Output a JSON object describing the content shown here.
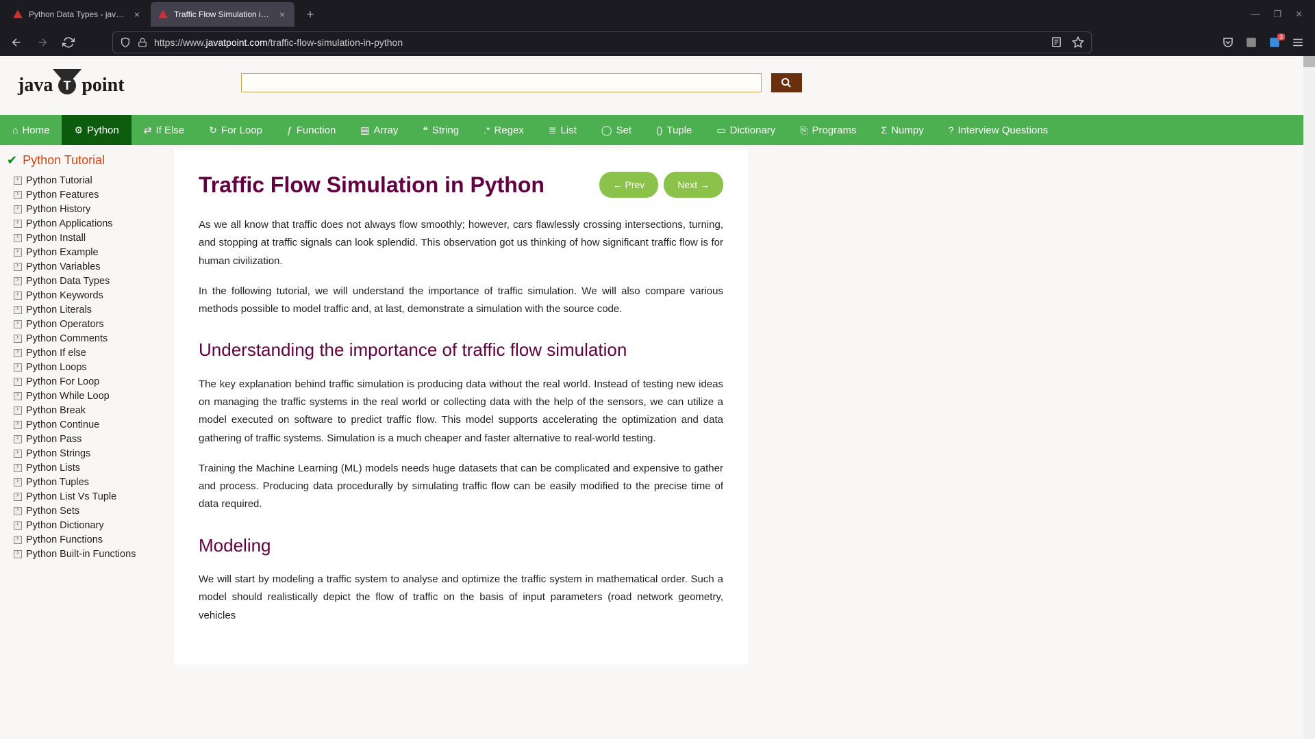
{
  "browser": {
    "tabs": [
      {
        "title": "Python Data Types - javatpoint",
        "active": false
      },
      {
        "title": "Traffic Flow Simulation in Pytho",
        "active": true
      }
    ],
    "url_prefix": "https://www.",
    "url_domain": "javatpoint.com",
    "url_path": "/traffic-flow-simulation-in-python",
    "ext_badge": "3"
  },
  "logo": {
    "part1": "java",
    "part2": "T",
    "part3": "point"
  },
  "green_nav": [
    {
      "label": "Home"
    },
    {
      "label": "Python"
    },
    {
      "label": "If Else"
    },
    {
      "label": "For Loop"
    },
    {
      "label": "Function"
    },
    {
      "label": "Array"
    },
    {
      "label": "String"
    },
    {
      "label": "Regex"
    },
    {
      "label": "List"
    },
    {
      "label": "Set"
    },
    {
      "label": "Tuple"
    },
    {
      "label": "Dictionary"
    },
    {
      "label": "Programs"
    },
    {
      "label": "Numpy"
    },
    {
      "label": "Interview Questions"
    }
  ],
  "sidebar": {
    "header": "Python Tutorial",
    "items": [
      "Python Tutorial",
      "Python Features",
      "Python History",
      "Python Applications",
      "Python Install",
      "Python Example",
      "Python Variables",
      "Python Data Types",
      "Python Keywords",
      "Python Literals",
      "Python Operators",
      "Python Comments",
      "Python If else",
      "Python Loops",
      "Python For Loop",
      "Python While Loop",
      "Python Break",
      "Python Continue",
      "Python Pass",
      "Python Strings",
      "Python Lists",
      "Python Tuples",
      "Python List Vs Tuple",
      "Python Sets",
      "Python Dictionary",
      "Python Functions",
      "Python Built-in Functions"
    ]
  },
  "article": {
    "title": "Traffic Flow Simulation in Python",
    "prev": "← Prev",
    "next": "Next →",
    "p1": "As we all know that traffic does not always flow smoothly; however, cars flawlessly crossing intersections, turning, and stopping at traffic signals can look splendid. This observation got us thinking of how significant traffic flow is for human civilization.",
    "p2": "In the following tutorial, we will understand the importance of traffic simulation. We will also compare various methods possible to model traffic and, at last, demonstrate a simulation with the source code.",
    "h2a": "Understanding the importance of traffic flow simulation",
    "p3": "The key explanation behind traffic simulation is producing data without the real world. Instead of testing new ideas on managing the traffic systems in the real world or collecting data with the help of the sensors, we can utilize a model executed on software to predict traffic flow. This model supports accelerating the optimization and data gathering of traffic systems. Simulation is a much cheaper and faster alternative to real-world testing.",
    "p4": "Training the Machine Learning (ML) models needs huge datasets that can be complicated and expensive to gather and process. Producing data procedurally by simulating traffic flow can be easily modified to the precise time of data required.",
    "h2b": "Modeling",
    "p5": "We will start by modeling a traffic system to analyse and optimize the traffic system in mathematical order. Such a model should realistically depict the flow of traffic on the basis of input parameters (road network geometry, vehicles"
  }
}
